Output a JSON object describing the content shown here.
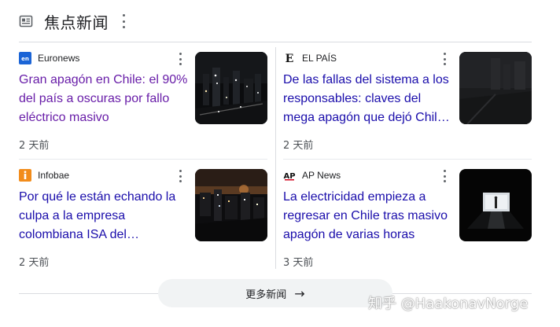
{
  "header": {
    "title": "焦点新闻",
    "icon": "newspaper-icon",
    "menu_icon": "more-vert-icon"
  },
  "cards": [
    {
      "source": "Euronews",
      "source_logo": "euronews-logo",
      "headline": "Gran apagón en Chile: el 90% del país a oscuras por fallo eléctrico masivo",
      "time": "2 天前",
      "visited": true,
      "thumbnail": "city-night-skyline-image"
    },
    {
      "source": "EL PAÍS",
      "source_logo": "el-pais-logo",
      "headline": "De las fallas del sistema a los responsables: claves del mega apagón que dejó Chil…",
      "time": "2 天前",
      "visited": false,
      "thumbnail": "dark-street-image"
    },
    {
      "source": "Infobae",
      "source_logo": "infobae-logo",
      "headline": "Por qué le están echando la culpa a la empresa colombiana ISA del…",
      "time": "2 天前",
      "visited": false,
      "thumbnail": "city-night-lights-image"
    },
    {
      "source": "AP News",
      "source_logo": "ap-news-logo",
      "headline": "La electricidad empieza a regresar en Chile tras masivo apagón de varias horas",
      "time": "3 天前",
      "visited": false,
      "thumbnail": "dark-hallway-person-image"
    }
  ],
  "more_button": {
    "label": "更多新闻",
    "icon": "arrow-right-icon"
  },
  "watermark": "知乎 @HaakonavNorge",
  "colors": {
    "link": "#1a0dab",
    "visited": "#681da8",
    "meta": "#4d5156",
    "divider": "#dadce0"
  }
}
